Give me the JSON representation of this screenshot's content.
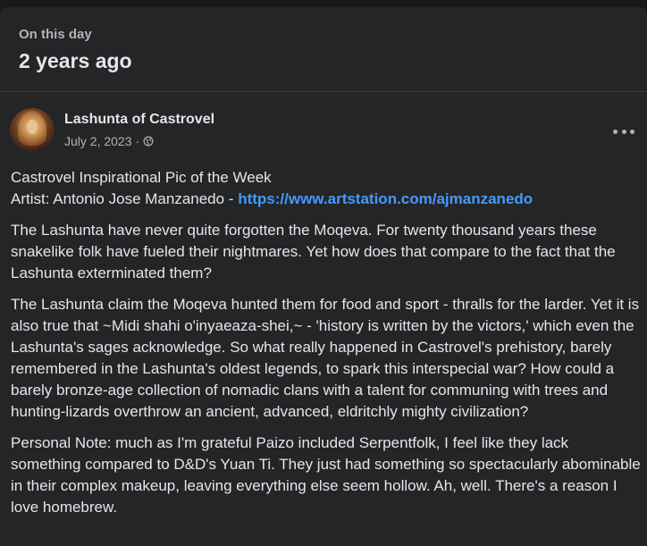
{
  "memory": {
    "kicker": "On this day",
    "title": "2 years ago"
  },
  "post": {
    "author": "Lashunta of Castrovel",
    "date": "July 2, 2023",
    "separator": "·",
    "privacy_icon": "globe-icon",
    "menu_icon": "more-options-icon",
    "caption_line1": "Castrovel Inspirational Pic of the Week",
    "artist_prefix": "Artist: Antonio Jose Manzanedo - ",
    "artist_link": "https://www.artstation.com/ajmanzanedo",
    "paragraphs": [
      "The Lashunta have never quite forgotten the Moqeva. For twenty thousand years these snakelike folk have fueled their nightmares. Yet how does that compare to the fact that the Lashunta exterminated them?",
      "The Lashunta claim the Moqeva hunted them for food and sport - thralls for the larder. Yet it is also true that ~Midi shahi o'inyaeaza-shei,~ - 'history is written by the victors,' which even the Lashunta's sages acknowledge. So what really happened in Castrovel's prehistory, barely remembered in the Lashunta's oldest legends, to spark this interspecial war? How could a barely bronze-age collection of nomadic clans with a talent for communing with trees and hunting-lizards overthrow an ancient, advanced, eldritchly mighty civilization?",
      "Personal Note: much as I'm grateful Paizo included Serpentfolk, I feel like they lack something compared to D&D's Yuan Ti. They just had something so spectacularly abominable in their complex makeup, leaving everything else seem hollow. Ah, well. There's a reason I love homebrew."
    ]
  },
  "colors": {
    "page_bg": "#18191a",
    "card_bg": "#242526",
    "primary_text": "#e4e6eb",
    "secondary_text": "#b0b3b8",
    "link": "#4599ff"
  }
}
